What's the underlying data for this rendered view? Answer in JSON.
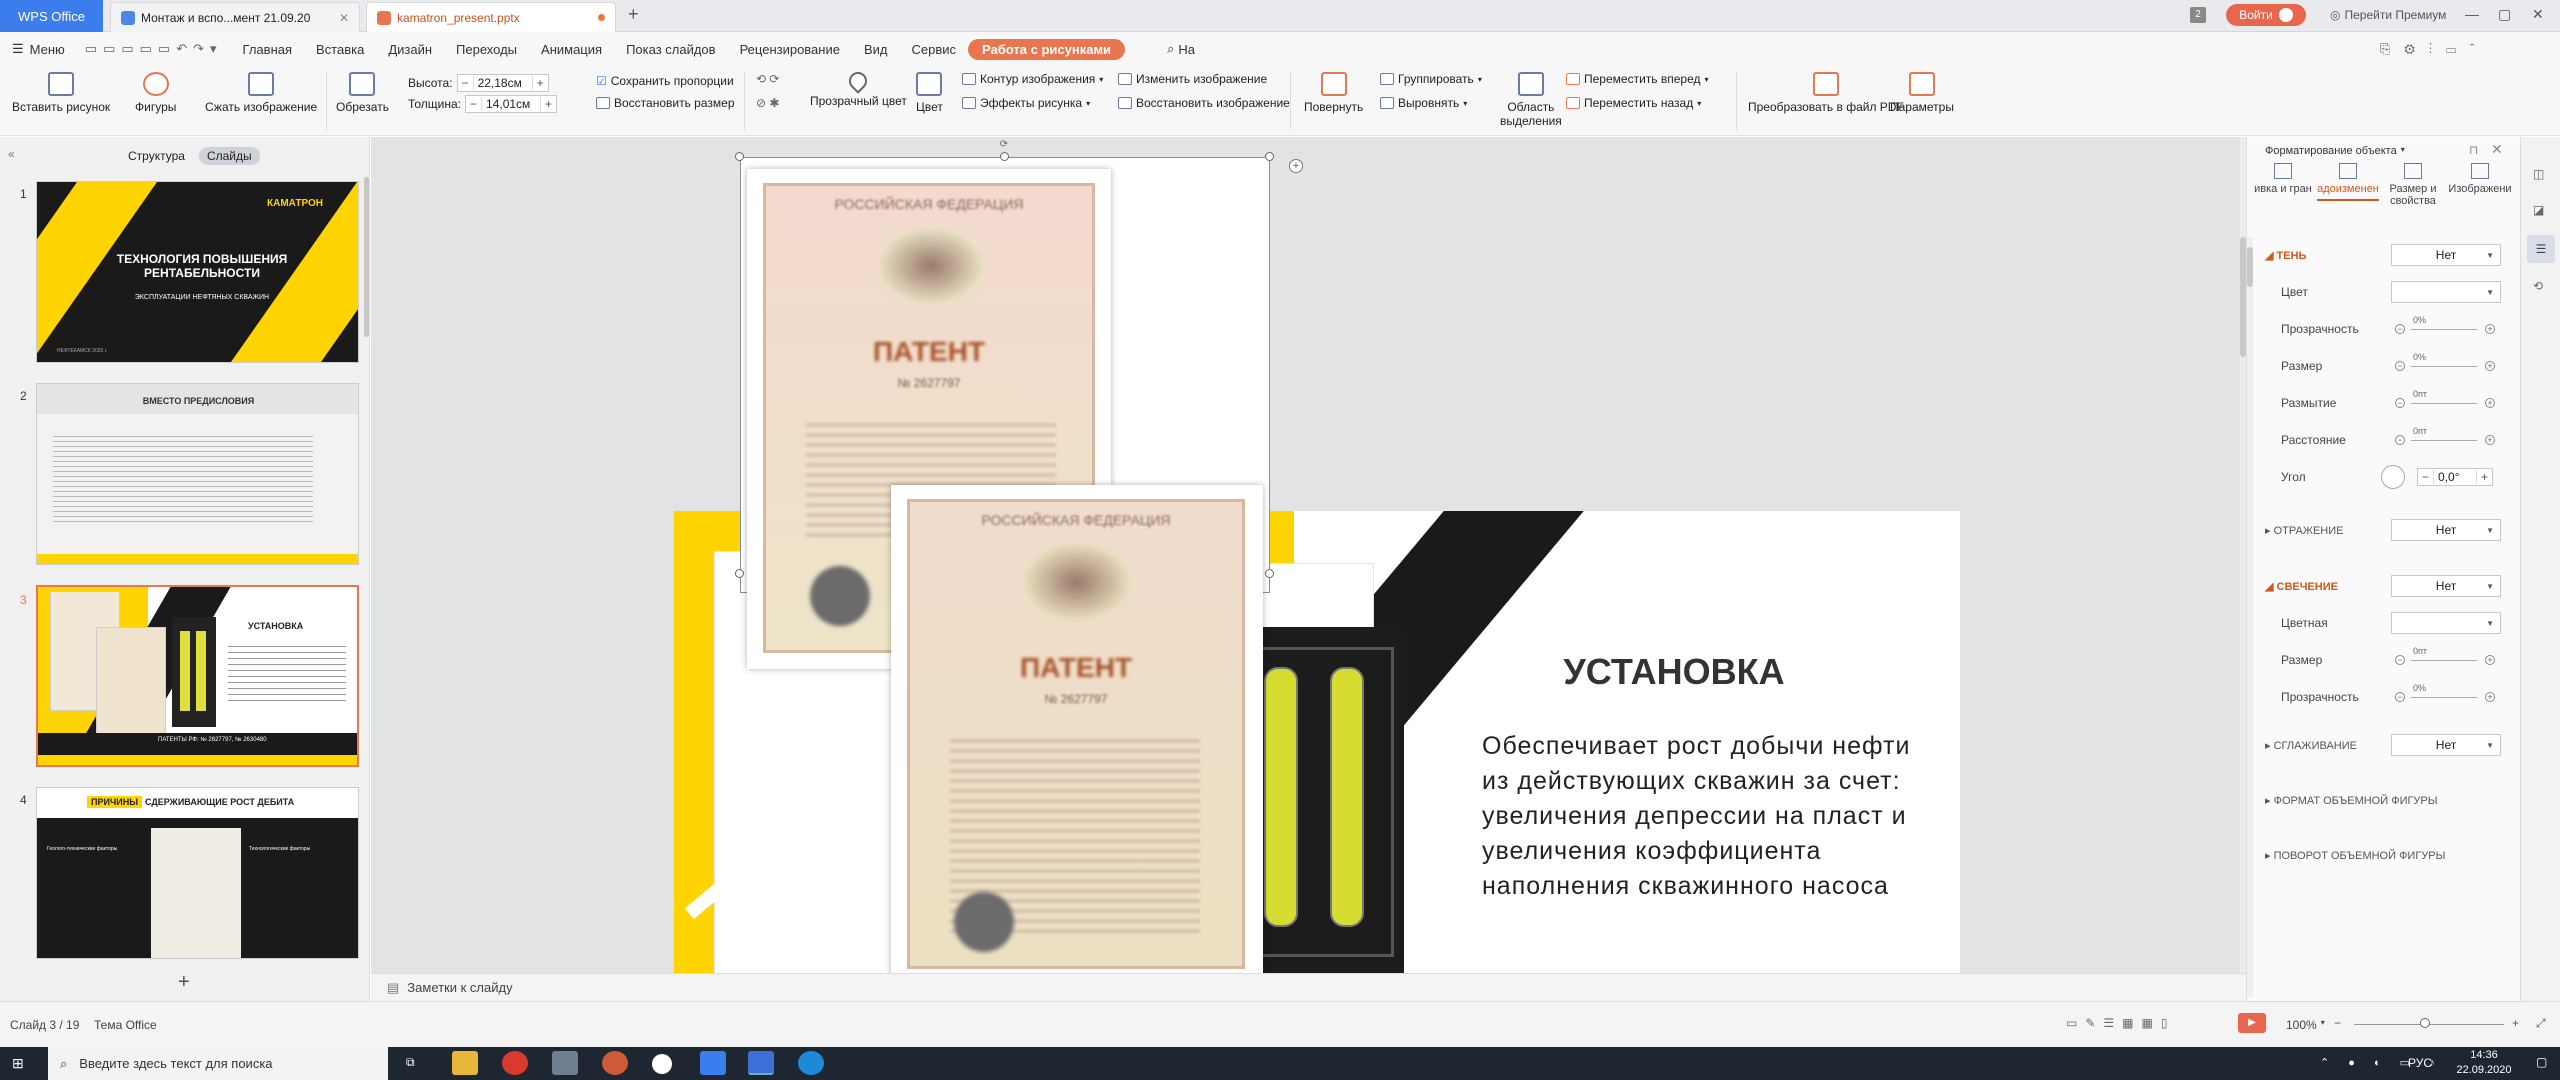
{
  "window": {
    "app_tab": "WPS Office",
    "tabs": [
      {
        "label": "Монтаж и вспо...мент 21.09.20"
      },
      {
        "label": "kamatron_present.pptx"
      }
    ],
    "counter": "2",
    "login_button": "Войти",
    "premium_button": "Перейти Премиум"
  },
  "menu": {
    "menu_button": "Меню",
    "items": [
      "Главная",
      "Вставка",
      "Дизайн",
      "Переходы",
      "Анимация",
      "Показ слайдов",
      "Рецензирование",
      "Вид",
      "Сервис"
    ],
    "context_tab": "Работа с рисунками",
    "search_placeholder": "На"
  },
  "ribbon": {
    "insert_picture": "Вставить рисунок",
    "shapes": "Фигуры",
    "compress": "Сжать изображение",
    "crop": "Обрезать",
    "height_label": "Высота:",
    "height_value": "22,18см",
    "width_label": "Толщина:",
    "width_value": "14,01см",
    "keep_ratio": "Сохранить пропорции",
    "restore_size": "Восстановить размер",
    "transparent_color": "Прозрачный цвет",
    "color": "Цвет",
    "outline": "Контур изображения",
    "effects": "Эффекты рисунка",
    "change_image": "Изменить изображение",
    "restore_image": "Восстановить изображение",
    "rotate": "Повернуть",
    "group": "Группировать",
    "align": "Выровнять",
    "selection_pane_1": "Область",
    "selection_pane_2": "выделения",
    "bring_forward": "Переместить вперед",
    "send_backward": "Переместить назад",
    "to_pdf": "Преобразовать в файл PDF",
    "params": "Параметры"
  },
  "left_panel": {
    "structure_tab": "Структура",
    "slides_tab": "Слайды",
    "slides": [
      {
        "num": "1",
        "title": "ТЕХНОЛОГИЯ ПОВЫШЕНИЯ РЕНТАБЕЛЬНОСТИ",
        "subtitle": "ЭКСПЛУАТАЦИИ НЕФТЯНЫХ СКВАЖИН",
        "logo": "КАМАТРОН",
        "date": "НЕФТЕКАМСК 2020 г."
      },
      {
        "num": "2",
        "title": "ВМЕСТО ПРЕДИСЛОВИЯ"
      },
      {
        "num": "3",
        "title": "УСТАНОВКА",
        "footer": "ПАТЕНТЫ РФ: № 2627797, № 2630480"
      },
      {
        "num": "4",
        "title_a": "ПРИЧИНЫ",
        "title_b": "СДЕРЖИВАЮЩИЕ РОСТ ДЕБИТА",
        "left_head": "Геолого-технические факторы",
        "right_head": "Технологические факторы"
      }
    ],
    "add_slide": "+"
  },
  "slide": {
    "title": "УСТАНОВКА",
    "body": "Обеспечивает рост добычи нефти из действующих скважин за счет: увеличения депрессии на пласт и увеличения коэффициента наполнения скважинного насоса",
    "patent1_header": "РОССИЙСКАЯ ФЕДЕРАЦИЯ",
    "patent1_title": "ПАТЕНТ",
    "patent1_num": "№ 2627797",
    "patent2_header": "РОССИЙСКАЯ ФЕДЕРАЦИЯ",
    "patent2_title": "ПАТЕНТ",
    "patent2_num": "№ 2627797"
  },
  "notes_placeholder": "Заметки к слайду",
  "format_panel": {
    "title": "Форматирование объекта",
    "tabs": [
      "ивка и гран",
      "адоизменен",
      "Размер и свойства",
      "Изображени"
    ],
    "shadow": "ТЕНЬ",
    "shadow_value": "Нет",
    "color": "Цвет",
    "transparency": "Прозрачность",
    "transparency_value": "0%",
    "size": "Размер",
    "size_value": "0%",
    "blur": "Размытие",
    "blur_value": "0пт",
    "distance": "Расстояние",
    "distance_value": "0пт",
    "angle": "Угол",
    "angle_value": "0,0°",
    "reflection": "ОТРАЖЕНИЕ",
    "reflection_value": "Нет",
    "glow": "СВЕЧЕНИЕ",
    "glow_value": "Нет",
    "glow_color": "Цветная",
    "glow_size": "Размер",
    "glow_size_value": "0пт",
    "glow_transparency": "Прозрачность",
    "glow_transparency_value": "0%",
    "smoothing": "СГЛАЖИВАНИЕ",
    "smoothing_value": "Нет",
    "format3d": "ФОРМАТ ОБЪЕМНОЙ ФИГУРЫ",
    "rotation3d": "ПОВОРОТ ОБЪЕМНОЙ ФИГУРЫ"
  },
  "status": {
    "slide_info": "Слайд 3 / 19",
    "theme": "Тема Office",
    "zoom": "100%"
  },
  "taskbar": {
    "search_placeholder": "Введите здесь текст для поиска",
    "lang": "РУС",
    "time": "14:36",
    "date": "22.09.2020"
  },
  "colors": {
    "accent": "#e8764e",
    "wps_blue": "#3b7ded",
    "slide_yellow": "#ffd400",
    "slide_dark": "#1a1a1a"
  }
}
